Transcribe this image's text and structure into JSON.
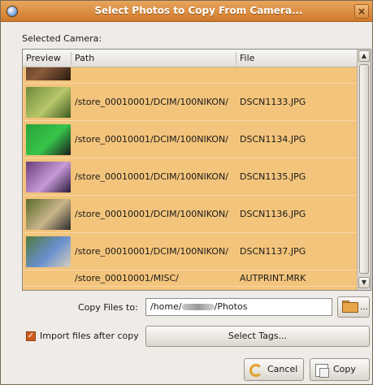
{
  "window": {
    "title": "Select Photos to Copy From Camera...",
    "close_glyph": "×"
  },
  "camera": {
    "label": "Selected Camera:"
  },
  "list": {
    "columns": [
      "Preview",
      "Path",
      "File"
    ],
    "partial_row": {
      "path": "",
      "file": ""
    },
    "rows": [
      {
        "path": "/store_00010001/DCIM/100NIKON/",
        "file": "DSCN1133.JPG",
        "thumb_colors": [
          "#6f8a3a",
          "#b8c86a",
          "#3b5a20"
        ]
      },
      {
        "path": "/store_00010001/DCIM/100NIKON/",
        "file": "DSCN1134.JPG",
        "thumb_colors": [
          "#2aa33a",
          "#37c44a",
          "#1b1b1b"
        ]
      },
      {
        "path": "/store_00010001/DCIM/100NIKON/",
        "file": "DSCN1135.JPG",
        "thumb_colors": [
          "#6a3d7a",
          "#c79ad8",
          "#2b1b3a"
        ]
      },
      {
        "path": "/store_00010001/DCIM/100NIKON/",
        "file": "DSCN1136.JPG",
        "thumb_colors": [
          "#5a6b2a",
          "#c9b58a",
          "#2a2a2a"
        ]
      },
      {
        "path": "/store_00010001/DCIM/100NIKON/",
        "file": "DSCN1137.JPG",
        "thumb_colors": [
          "#4f7a3f",
          "#6a8fd0",
          "#d8d0b8"
        ]
      }
    ],
    "last_row": {
      "path": "/store_00010001/MISC/",
      "file": "AUTPRINT.MRK"
    }
  },
  "copy_to": {
    "label": "Copy Files to:",
    "value_prefix": "/home/",
    "value_suffix": "/Photos"
  },
  "options": {
    "import_label": "Import files after copy",
    "import_checked": true,
    "select_tags_label": "Select Tags..."
  },
  "buttons": {
    "cancel": "Cancel",
    "copy": "Copy"
  },
  "colors": {
    "selection": "#f3c47b",
    "titlebar": "#d07a2c"
  }
}
